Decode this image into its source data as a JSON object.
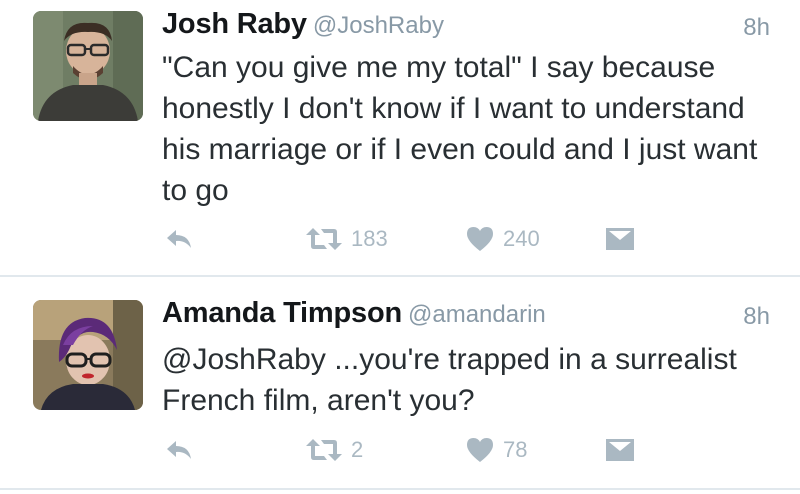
{
  "tweets": [
    {
      "name": "Josh Raby",
      "handle": "@JoshRaby",
      "time": "8h",
      "text": "\"Can you give me my total\" I say because honestly I don't know if I want to understand his marriage or if I even could and I just want to go",
      "retweets": "183",
      "likes": "240"
    },
    {
      "name": "Amanda Timpson",
      "handle": "@amandarin",
      "time": "8h",
      "text": "@JoshRaby ...you're trapped in a surrealist French film, aren't you?",
      "retweets": "2",
      "likes": "78"
    }
  ],
  "icons": {
    "reply": "reply-icon",
    "retweet": "retweet-icon",
    "like": "heart-icon",
    "message": "envelope-icon"
  },
  "colors": {
    "icon_gray": "#aab8c2",
    "meta_gray": "#8899a6",
    "divider": "#e1e8ed"
  }
}
